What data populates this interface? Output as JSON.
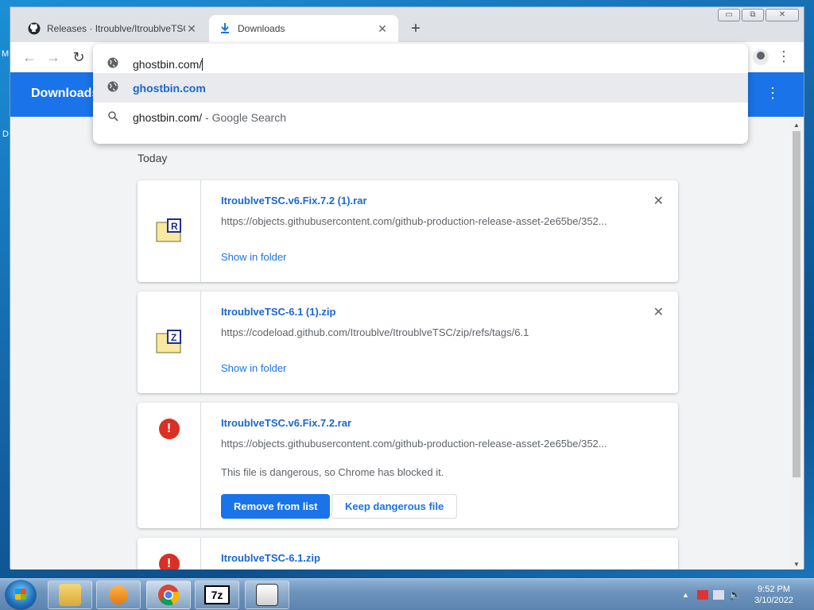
{
  "browser": {
    "tabs": [
      {
        "title": "Releases · Itroublve/ItroublveTSC",
        "icon": "github-icon",
        "active": false
      },
      {
        "title": "Downloads",
        "icon": "download-icon",
        "active": true
      }
    ],
    "window_controls": {
      "minimize": "▭",
      "maximize": "⧉",
      "close": "✕"
    }
  },
  "omnibox": {
    "input_value": "ghostbin.com/",
    "suggestions": [
      {
        "text": "ghostbin.com",
        "icon": "globe-icon",
        "selected": true
      },
      {
        "text": "ghostbin.com/",
        "description": " - Google Search",
        "icon": "search-icon",
        "selected": false
      }
    ]
  },
  "downloads_page": {
    "header_title": "Downloads",
    "section_label": "Today",
    "items": [
      {
        "filename": "ItroublveTSC.v6.Fix.7.2 (1).rar",
        "url": "https://objects.githubusercontent.com/github-production-release-asset-2e65be/352...",
        "action_link": "Show in folder",
        "icon": "rar-archive-icon"
      },
      {
        "filename": "ItroublveTSC-6.1 (1).zip",
        "url": "https://codeload.github.com/Itroublve/ItroublveTSC/zip/refs/tags/6.1",
        "action_link": "Show in folder",
        "icon": "zip-archive-icon"
      },
      {
        "filename": "ItroublveTSC.v6.Fix.7.2.rar",
        "url": "https://objects.githubusercontent.com/github-production-release-asset-2e65be/352...",
        "warning": "This file is dangerous, so Chrome has blocked it.",
        "remove_label": "Remove from list",
        "keep_label": "Keep dangerous file",
        "icon": "danger-icon"
      },
      {
        "filename": "ItroublveTSC-6.1.zip",
        "icon": "danger-icon"
      }
    ]
  },
  "taskbar": {
    "time": "9:52 PM",
    "date": "3/10/2022",
    "apps": [
      "file-explorer-icon",
      "media-player-icon",
      "chrome-icon",
      "7zip-icon",
      "mascot-app-icon"
    ],
    "app_7zip_label": "7z"
  },
  "colors": {
    "accent": "#1a73e8",
    "danger": "#d93025",
    "link": "#1967d2"
  }
}
